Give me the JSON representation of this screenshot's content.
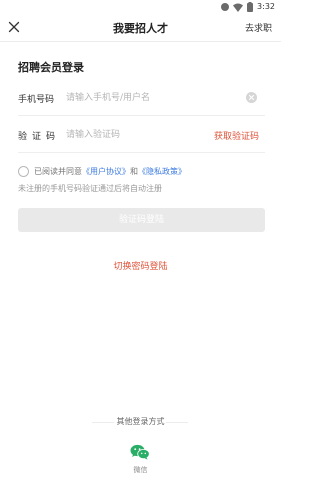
{
  "status": {
    "time": "3:32",
    "icons": [
      "signal-icon",
      "wifi-icon",
      "battery-icon"
    ]
  },
  "nav": {
    "title": "我要招人才",
    "right": "去求职",
    "close_icon": "close-icon"
  },
  "section": {
    "title": "招聘会员登录"
  },
  "phone": {
    "label": "手机号码",
    "placeholder": "请输入手机号/用户名",
    "value": ""
  },
  "code": {
    "label": "验证码",
    "placeholder": "请输入验证码",
    "value": "",
    "action": "获取验证码"
  },
  "agree": {
    "prefix": "已阅读并同意",
    "user_agreement": "《用户协议》",
    "and": "和",
    "privacy": "《隐私政策》",
    "checked": false
  },
  "hint": "未注册的手机号码验证通过后将自动注册",
  "login_button": "验证码登陆",
  "switch_login": "切换密码登陆",
  "other": {
    "title": "其他登录方式",
    "wechat_label": "微信"
  },
  "colors": {
    "accent": "#e0533a",
    "link": "#3d7be0",
    "button_disabled": "#e9e9e9",
    "wechat": "#2aae67"
  }
}
